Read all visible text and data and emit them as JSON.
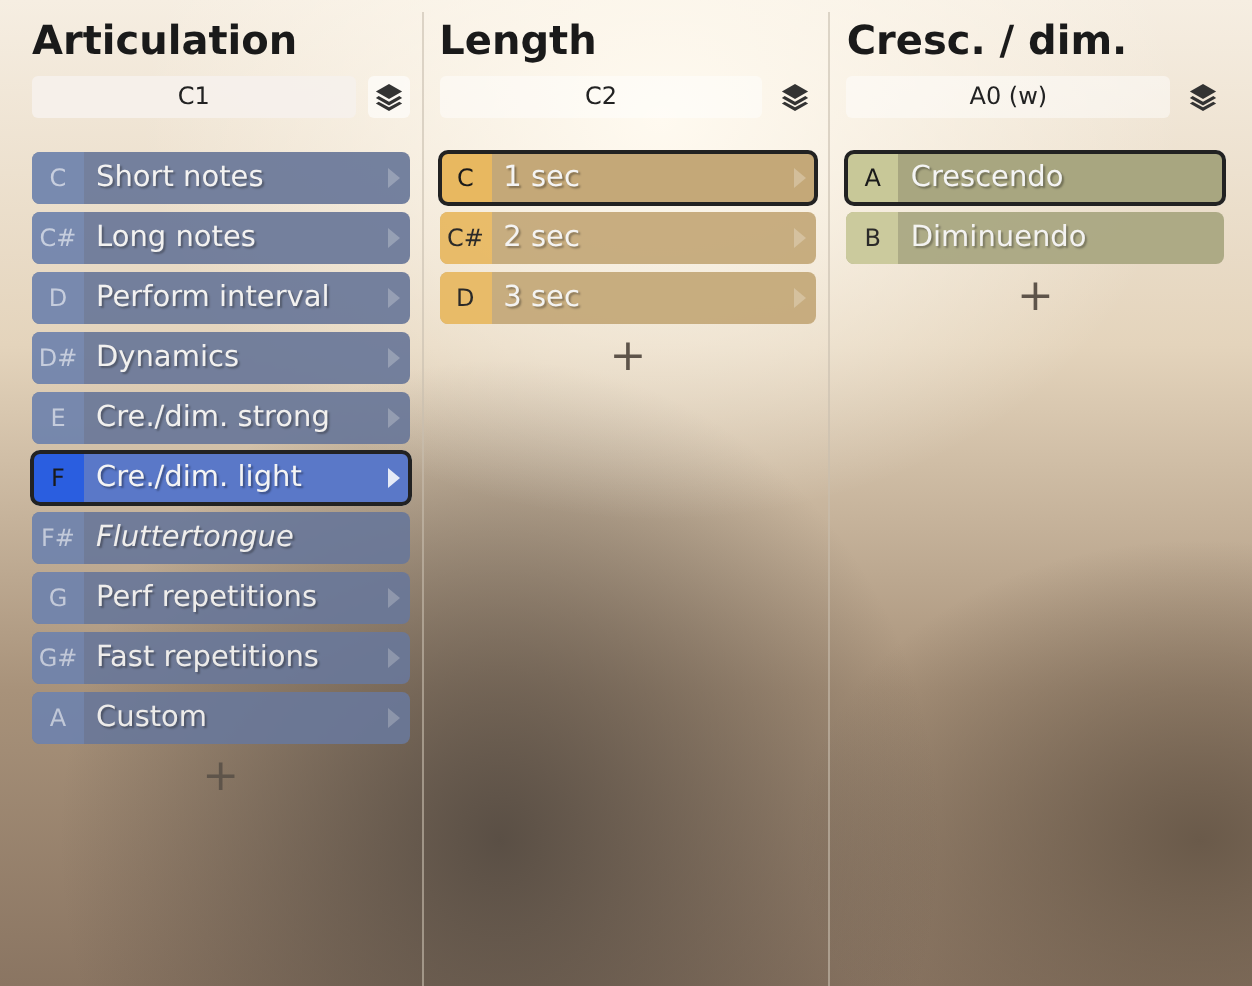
{
  "columns": [
    {
      "title": "Articulation",
      "key_field": "C1",
      "color": "#6a7899",
      "items": [
        {
          "key": "C",
          "label": "Short notes",
          "selected": false,
          "italic": false,
          "submenu": true
        },
        {
          "key": "C#",
          "label": "Long notes",
          "selected": false,
          "italic": false,
          "submenu": true
        },
        {
          "key": "D",
          "label": "Perform interval",
          "selected": false,
          "italic": false,
          "submenu": true
        },
        {
          "key": "D#",
          "label": "Dynamics",
          "selected": false,
          "italic": false,
          "submenu": true
        },
        {
          "key": "E",
          "label": "Cre./dim. strong",
          "selected": false,
          "italic": false,
          "submenu": true
        },
        {
          "key": "F",
          "label": "Cre./dim. light",
          "selected": true,
          "italic": false,
          "submenu": true
        },
        {
          "key": "F#",
          "label": "Fluttertongue",
          "selected": false,
          "italic": true,
          "submenu": false
        },
        {
          "key": "G",
          "label": "Perf repetitions",
          "selected": false,
          "italic": false,
          "submenu": true
        },
        {
          "key": "G#",
          "label": "Fast repetitions",
          "selected": false,
          "italic": false,
          "submenu": true
        },
        {
          "key": "A",
          "label": "Custom",
          "selected": false,
          "italic": false,
          "submenu": true
        }
      ],
      "add": "+"
    },
    {
      "title": "Length",
      "key_field": "C2",
      "color": "#c4a878",
      "items": [
        {
          "key": "C",
          "label": "1 sec",
          "selected": true,
          "italic": false,
          "submenu": true
        },
        {
          "key": "C#",
          "label": "2 sec",
          "selected": false,
          "italic": false,
          "submenu": true
        },
        {
          "key": "D",
          "label": "3 sec",
          "selected": false,
          "italic": false,
          "submenu": true
        }
      ],
      "add": "+"
    },
    {
      "title": "Cresc. / dim.",
      "key_field": "A0 (w)",
      "color": "#a8a680",
      "items": [
        {
          "key": "A",
          "label": "Crescendo",
          "selected": true,
          "italic": false,
          "submenu": false
        },
        {
          "key": "B",
          "label": "Diminuendo",
          "selected": false,
          "italic": false,
          "submenu": false
        }
      ],
      "add": "+"
    }
  ]
}
